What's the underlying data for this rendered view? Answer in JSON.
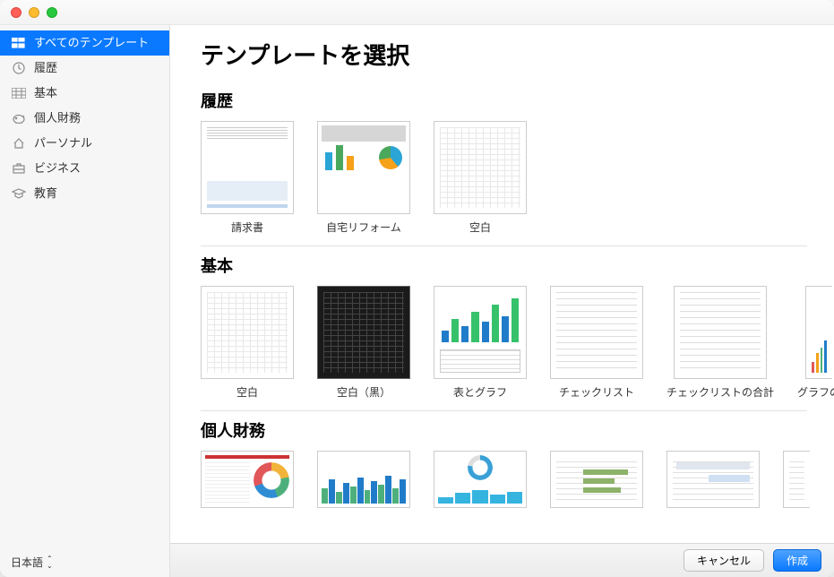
{
  "pageTitle": "テンプレートを選択",
  "sidebar": {
    "items": [
      {
        "label": "すべてのテンプレート",
        "active": true
      },
      {
        "label": "履歴",
        "active": false
      },
      {
        "label": "基本",
        "active": false
      },
      {
        "label": "個人財務",
        "active": false
      },
      {
        "label": "パーソナル",
        "active": false
      },
      {
        "label": "ビジネス",
        "active": false
      },
      {
        "label": "教育",
        "active": false
      }
    ]
  },
  "language": "日本語",
  "sections": {
    "recent": {
      "title": "履歴",
      "items": [
        {
          "label": "請求書"
        },
        {
          "label": "自宅リフォーム"
        },
        {
          "label": "空白"
        }
      ]
    },
    "basic": {
      "title": "基本",
      "items": [
        {
          "label": "空白"
        },
        {
          "label": "空白（黒）"
        },
        {
          "label": "表とグラフ"
        },
        {
          "label": "チェックリスト"
        },
        {
          "label": "チェックリストの合計"
        },
        {
          "label": "グラフの"
        }
      ]
    },
    "personalFinance": {
      "title": "個人財務"
    }
  },
  "footer": {
    "cancel": "キャンセル",
    "create": "作成"
  },
  "colors": {
    "accent": "#0a79ff",
    "sidebarBg": "#f6f6f6"
  }
}
